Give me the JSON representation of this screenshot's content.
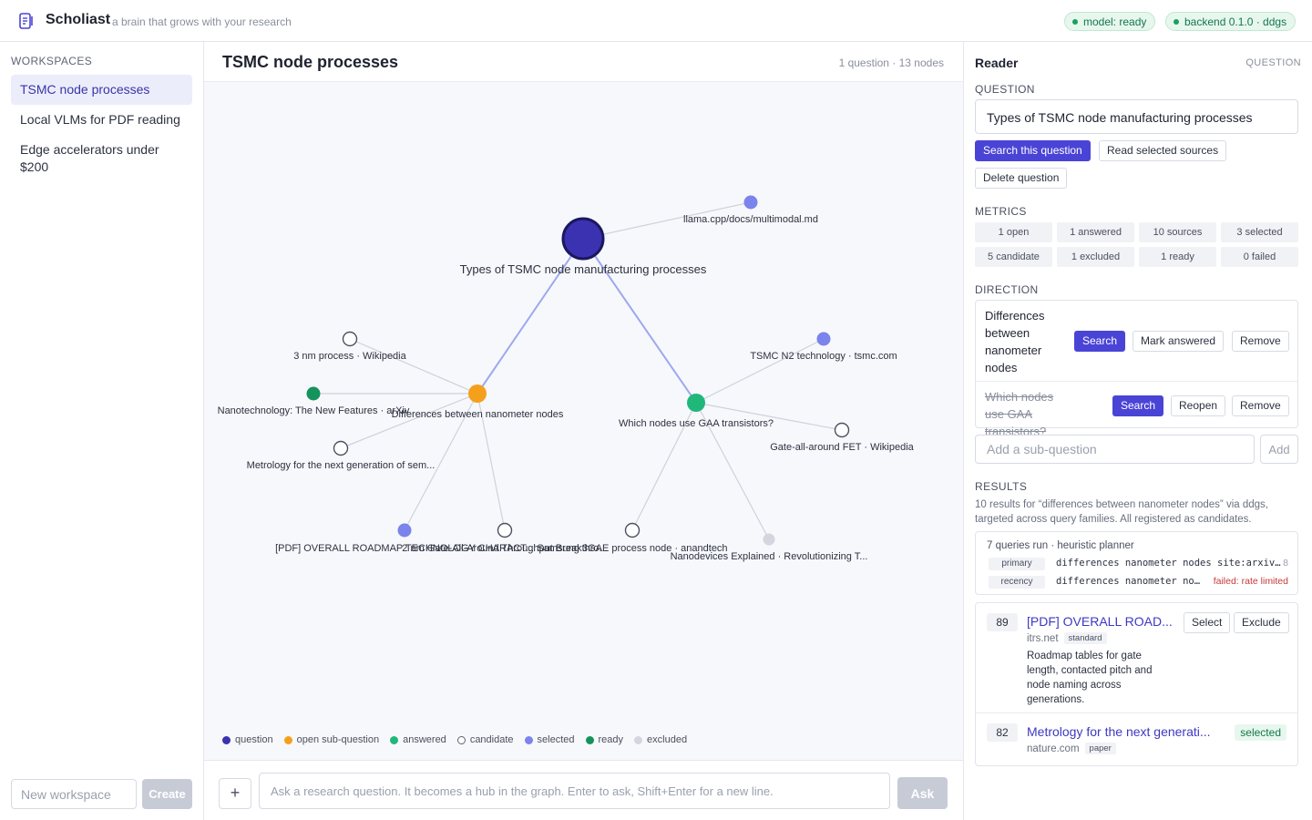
{
  "app": {
    "name": "Scholiast",
    "tagline": "a brain that grows with your research",
    "status_model": "model: ready",
    "status_backend": "backend 0.1.0 · ddgs"
  },
  "sidebar": {
    "title": "WORKSPACES",
    "items": [
      {
        "label": "TSMC node processes",
        "active": true
      },
      {
        "label": "Local VLMs for PDF reading",
        "active": false
      },
      {
        "label": "Edge accelerators under $200",
        "active": false
      }
    ],
    "new_workspace_placeholder": "New workspace",
    "create_label": "Create"
  },
  "workspace": {
    "title": "TSMC node processes",
    "meta": "1 question · 13 nodes"
  },
  "graph": {
    "colors": {
      "question": "#3a32b0",
      "open": "#f4a01c",
      "answered": "#1fb87a",
      "candidate": "#ffffff",
      "selected": "#7b83ec",
      "ready": "#15935c",
      "excluded": "#d3d6de",
      "edge_main": "#9ea8ee",
      "edge_minor": "#cdd2dc"
    },
    "nodes": [
      {
        "id": "q",
        "type": "question",
        "label": "Types of TSMC node manufacturing processes"
      },
      {
        "id": "s1",
        "type": "open",
        "label": "Differences between nanometer nodes"
      },
      {
        "id": "s2",
        "type": "answered",
        "label": "Which nodes use GAA transistors?"
      },
      {
        "id": "c1",
        "type": "selected",
        "label": "llama.cpp/docs/multimodal.md"
      },
      {
        "id": "c2",
        "type": "candidate",
        "label": "3 nm process · Wikipedia"
      },
      {
        "id": "c3",
        "type": "ready",
        "label": "Nanotechnology: The New Features · arXiv"
      },
      {
        "id": "c4",
        "type": "candidate",
        "label": "Metrology for the next generation of sem..."
      },
      {
        "id": "c5",
        "type": "selected",
        "label": "[PDF] OVERALL ROADMAP TECHNOLOGY CHARACT..."
      },
      {
        "id": "c6",
        "type": "candidate",
        "label": "2 nm Gate-All-Around Throughput Breakthro..."
      },
      {
        "id": "c7",
        "type": "selected",
        "label": "TSMC N2 technology · tsmc.com"
      },
      {
        "id": "c8",
        "type": "candidate",
        "label": "Gate-all-around FET · Wikipedia"
      },
      {
        "id": "c9",
        "type": "candidate",
        "label": "Samsung 3GAE process node · anandtech"
      },
      {
        "id": "c10",
        "type": "excluded",
        "label": "Nanodevices Explained · Revolutionizing T..."
      }
    ],
    "edges": [
      [
        "q",
        "s1"
      ],
      [
        "q",
        "s2"
      ],
      [
        "q",
        "c1"
      ],
      [
        "s1",
        "c2"
      ],
      [
        "s1",
        "c3"
      ],
      [
        "s1",
        "c4"
      ],
      [
        "s1",
        "c5"
      ],
      [
        "s1",
        "c6"
      ],
      [
        "s2",
        "c7"
      ],
      [
        "s2",
        "c8"
      ],
      [
        "s2",
        "c9"
      ],
      [
        "s2",
        "c10"
      ]
    ],
    "legend": [
      {
        "key": "question",
        "label": "question"
      },
      {
        "key": "open",
        "label": "open sub-question"
      },
      {
        "key": "answered",
        "label": "answered"
      },
      {
        "key": "candidate",
        "label": "candidate"
      },
      {
        "key": "selected",
        "label": "selected"
      },
      {
        "key": "ready",
        "label": "ready"
      },
      {
        "key": "excluded",
        "label": "excluded"
      }
    ]
  },
  "ask": {
    "placeholder": "Ask a research question. It becomes a hub in the graph. Enter to ask, Shift+Enter for a new line.",
    "plus_label": "+",
    "button_label": "Ask"
  },
  "reader": {
    "title": "Reader",
    "kind": "QUESTION",
    "question_label": "QUESTION",
    "question_text": "Types of TSMC node manufacturing processes",
    "btn_search": "Search this question",
    "btn_read": "Read selected sources",
    "btn_delete": "Delete question",
    "metrics_label": "METRICS",
    "metrics": [
      "1 open",
      "1 answered",
      "10 sources",
      "3 selected",
      "5 candidate",
      "1 excluded",
      "1 ready",
      "0 failed"
    ],
    "direction_label": "DIRECTION",
    "directions": [
      {
        "text": "Differences between nanometer nodes",
        "done": false,
        "actions": [
          "Search",
          "Mark answered",
          "Remove"
        ]
      },
      {
        "text": "Which nodes use GAA transistors?",
        "done": true,
        "actions": [
          "Search",
          "Reopen",
          "Remove"
        ]
      }
    ],
    "sub_placeholder": "Add a sub-question",
    "add_label": "Add",
    "results_label": "RESULTS",
    "results_desc": "10 results for “differences between nanometer nodes” via ddgs, targeted across query families. All registered as candidates.",
    "runs": {
      "title": "7 queries run · heuristic planner",
      "rows": [
        {
          "tag": "primary",
          "query": "differences nanometer nodes site:arxiv…",
          "count": "8",
          "failed": ""
        },
        {
          "tag": "recency",
          "query": "differences nanometer no…",
          "count": "",
          "failed": "failed: rate limited"
        }
      ]
    },
    "sources": [
      {
        "score": "89",
        "title": "[PDF] OVERALL ROAD...",
        "domain": "itrs.net",
        "badge": "standard",
        "desc": "Roadmap tables for gate length, contacted pitch and node naming across generations.",
        "actions": [
          "Select",
          "Exclude"
        ],
        "status": ""
      },
      {
        "score": "82",
        "title": "Metrology for the next generati...",
        "domain": "nature.com",
        "badge": "paper",
        "desc": "",
        "actions": [],
        "status": "selected"
      }
    ]
  }
}
